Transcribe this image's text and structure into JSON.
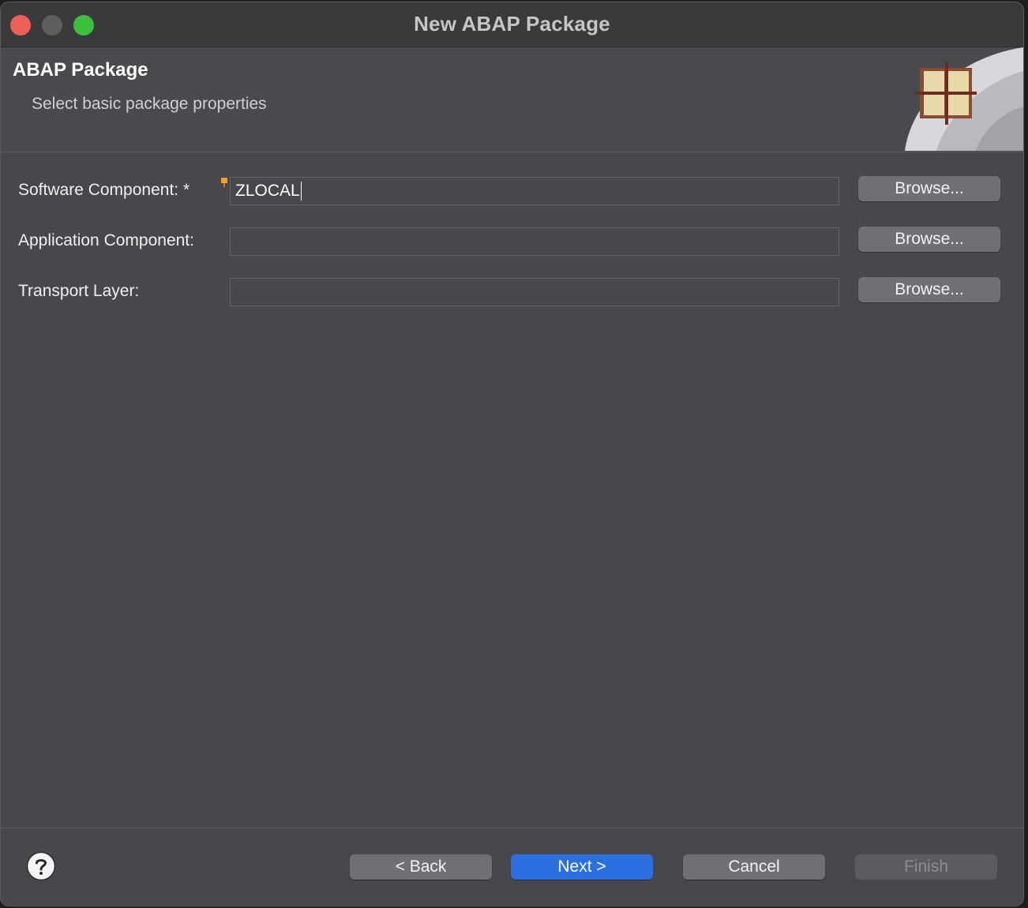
{
  "window": {
    "title": "New ABAP Package"
  },
  "banner": {
    "title": "ABAP Package",
    "subtitle": "Select basic package properties",
    "icon": "abap-package-icon"
  },
  "form": {
    "software_component": {
      "label": "Software Component: *",
      "value": "ZLOCAL",
      "browse_label": "Browse..."
    },
    "application_component": {
      "label": "Application Component:",
      "value": "",
      "browse_label": "Browse..."
    },
    "transport_layer": {
      "label": "Transport Layer:",
      "value": "",
      "browse_label": "Browse..."
    }
  },
  "footer": {
    "help_icon": "help-icon",
    "back_label": "< Back",
    "next_label": "Next >",
    "cancel_label": "Cancel",
    "finish_label": "Finish"
  },
  "colors": {
    "primary_button": "#2d6fe0",
    "close_button": "#ee5f58",
    "zoom_button": "#3fbf3f",
    "required_marker": "#f0a030"
  }
}
